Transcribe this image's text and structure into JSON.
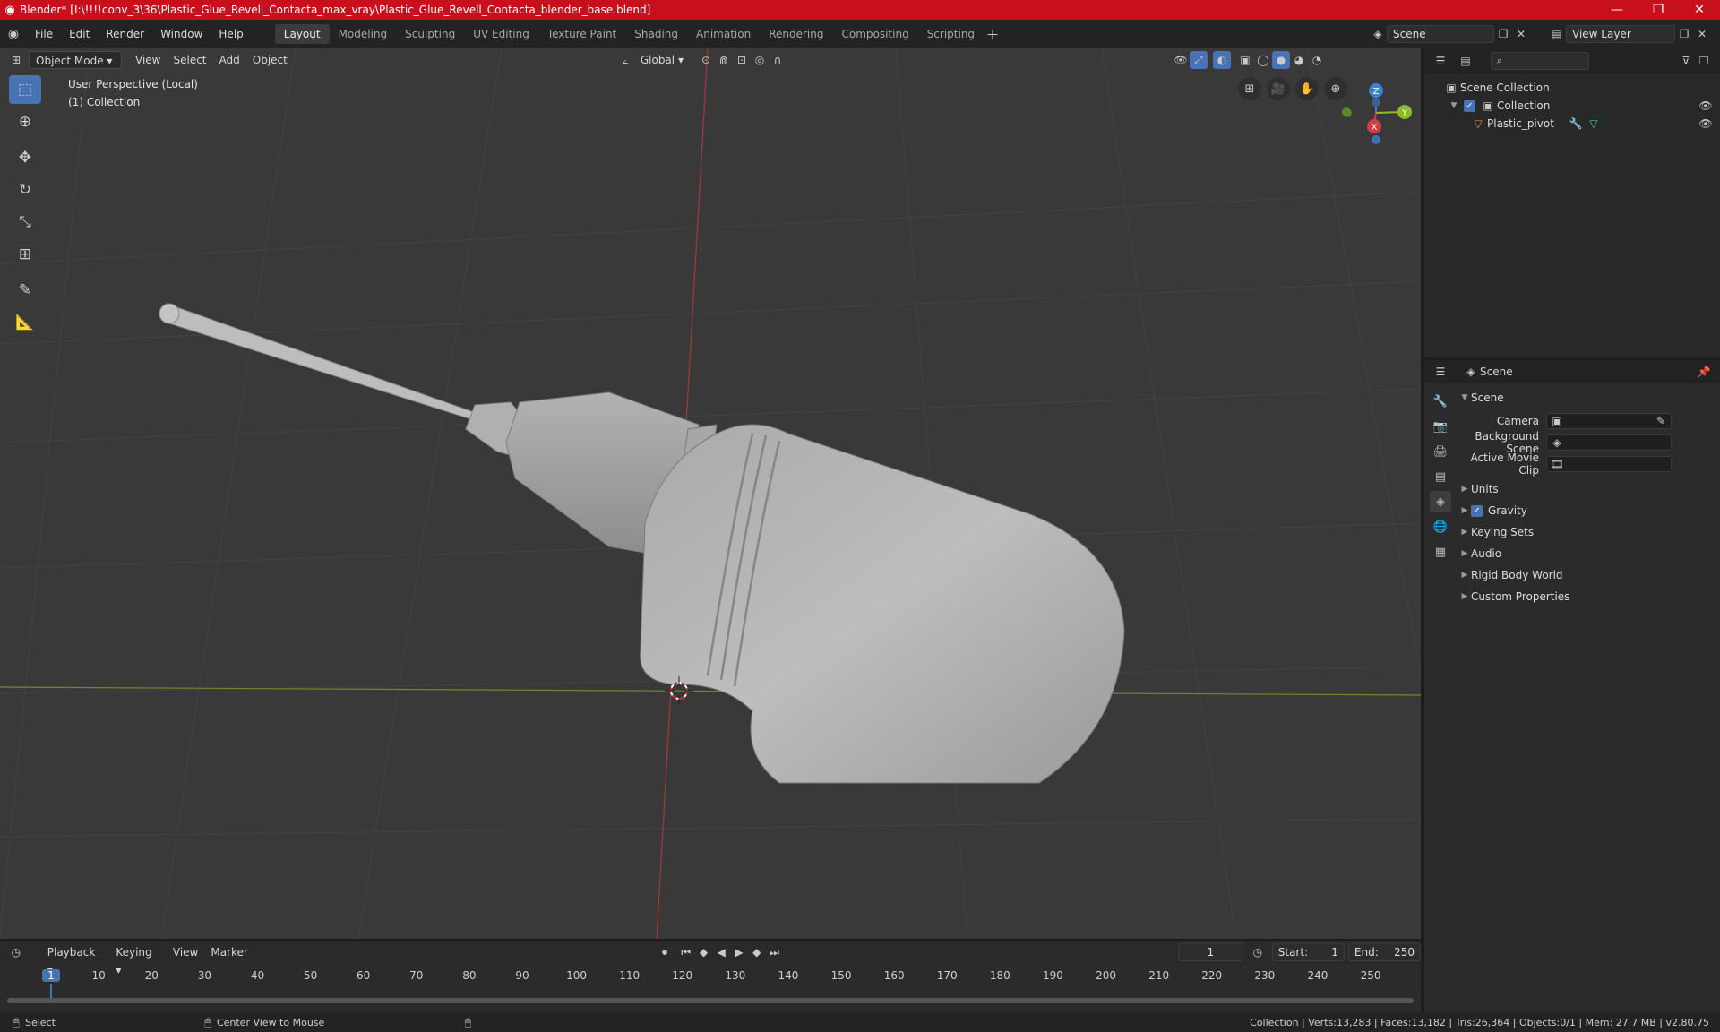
{
  "window": {
    "title": "Blender* [I:\\!!!!conv_3\\36\\Plastic_Glue_Revell_Contacta_max_vray\\Plastic_Glue_Revell_Contacta_blender_base.blend]",
    "controls": [
      "—",
      "❐",
      "✕"
    ]
  },
  "menus": [
    "File",
    "Edit",
    "Render",
    "Window",
    "Help"
  ],
  "workspaces": [
    {
      "label": "Layout",
      "active": true
    },
    {
      "label": "Modeling"
    },
    {
      "label": "Sculpting"
    },
    {
      "label": "UV Editing"
    },
    {
      "label": "Texture Paint"
    },
    {
      "label": "Shading"
    },
    {
      "label": "Animation"
    },
    {
      "label": "Rendering"
    },
    {
      "label": "Compositing"
    },
    {
      "label": "Scripting"
    }
  ],
  "scene_selector": "Scene",
  "view_layer": "View Layer",
  "viewport_header": {
    "mode": "Object Mode",
    "menus": [
      "View",
      "Select",
      "Add",
      "Object"
    ],
    "transform_orientation": "Global"
  },
  "viewport_overlay": {
    "line1": "User Perspective (Local)",
    "line2": "(1) Collection"
  },
  "gizmo": {
    "z": "Z",
    "y": "Y",
    "x": "X"
  },
  "outliner": {
    "root": "Scene Collection",
    "collection": "Collection",
    "object": "Plastic_pivot"
  },
  "properties": {
    "header": "Scene",
    "section": "Scene",
    "fields": [
      {
        "label": "Camera"
      },
      {
        "label": "Background Scene"
      },
      {
        "label": "Active Movie Clip"
      }
    ],
    "panels": [
      "Units",
      "Gravity",
      "Keying Sets",
      "Audio",
      "Rigid Body World",
      "Custom Properties"
    ]
  },
  "timeline": {
    "menus": [
      "Playback",
      "Keying",
      "View",
      "Marker"
    ],
    "current_frame": "1",
    "start_label": "Start:",
    "start": "1",
    "end_label": "End:",
    "end": "250",
    "ruler": [
      "1",
      "10",
      "20",
      "30",
      "40",
      "50",
      "60",
      "70",
      "80",
      "90",
      "100",
      "110",
      "120",
      "130",
      "140",
      "150",
      "160",
      "170",
      "180",
      "190",
      "200",
      "210",
      "220",
      "230",
      "240",
      "250"
    ]
  },
  "statusbar": {
    "select": "Select",
    "center": "Center View to Mouse",
    "stats": "Collection | Verts:13,283 | Faces:13,182 | Tris:26,364 | Objects:0/1 | Mem: 27.7 MB | v2.80.75"
  },
  "colors": {
    "accent": "#4772b3",
    "titlebar": "#c8101d",
    "x_axis": "#d33b45",
    "y_axis": "#8bbd2b",
    "z_axis": "#3d7fd6"
  }
}
